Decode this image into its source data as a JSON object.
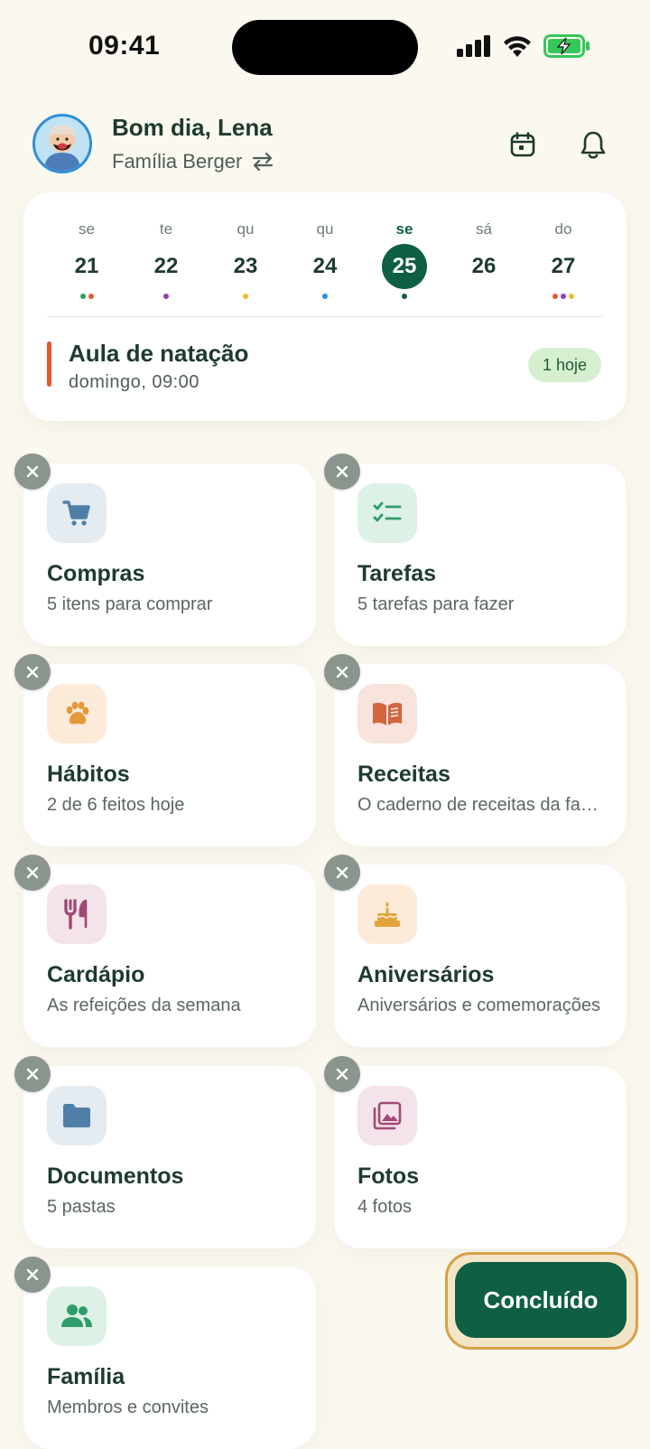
{
  "status_bar": {
    "time": "09:41"
  },
  "header": {
    "greeting": "Bom dia, Lena",
    "family_name": "Família Berger"
  },
  "calendar": {
    "days": [
      {
        "dow": "se",
        "num": "21",
        "dots": [
          "#2E9D5B",
          "#E9552B"
        ]
      },
      {
        "dow": "te",
        "num": "22",
        "dots": [
          "#8E3FB5"
        ]
      },
      {
        "dow": "qu",
        "num": "23",
        "dots": [
          "#F2B92B"
        ]
      },
      {
        "dow": "qu",
        "num": "24",
        "dots": [
          "#2E8FD6"
        ]
      },
      {
        "dow": "se",
        "num": "25",
        "dots": [
          "#0E5F43"
        ],
        "active": true
      },
      {
        "dow": "sá",
        "num": "26",
        "dots": []
      },
      {
        "dow": "do",
        "num": "27",
        "dots": [
          "#E9552B",
          "#8E3FB5",
          "#F2B92B"
        ]
      }
    ],
    "event": {
      "title": "Aula de natação",
      "time": "domingo, 09:00",
      "badge": "1 hoje",
      "color": "#E9552B"
    }
  },
  "widgets": [
    {
      "title": "Compras",
      "subtitle": "5 itens para comprar",
      "icon": "cart-icon",
      "bg": "#E4EBF1",
      "fg": "#4F7FA8"
    },
    {
      "title": "Tarefas",
      "subtitle": "5 tarefas para fazer",
      "icon": "checklist-icon",
      "bg": "#DDF1E6",
      "fg": "#2E9D6B"
    },
    {
      "title": "Hábitos",
      "subtitle": "2 de 6 feitos hoje",
      "icon": "paw-icon",
      "bg": "#FCEBD9",
      "fg": "#E39A3A"
    },
    {
      "title": "Receitas",
      "subtitle": "O caderno de receitas da família",
      "icon": "book-icon",
      "bg": "#F8E3DD",
      "fg": "#D1663F"
    },
    {
      "title": "Cardápio",
      "subtitle": "As refeições da semana",
      "icon": "cutlery-icon",
      "bg": "#F4E3EA",
      "fg": "#9E4A77"
    },
    {
      "title": "Aniversários",
      "subtitle": "Aniversários e comemorações",
      "icon": "cake-icon",
      "bg": "#FCEBD9",
      "fg": "#E3A43A"
    },
    {
      "title": "Documentos",
      "subtitle": "5 pastas",
      "icon": "folder-icon",
      "bg": "#E4EBF1",
      "fg": "#4F7FA8"
    },
    {
      "title": "Fotos",
      "subtitle": "4 fotos",
      "icon": "photos-icon",
      "bg": "#F4E3EA",
      "fg": "#9E4A77"
    },
    {
      "title": "Família",
      "subtitle": "Membros e convites",
      "icon": "people-icon",
      "bg": "#DDF1E6",
      "fg": "#2E9D6B"
    }
  ],
  "done_button": {
    "label": "Concluído"
  }
}
